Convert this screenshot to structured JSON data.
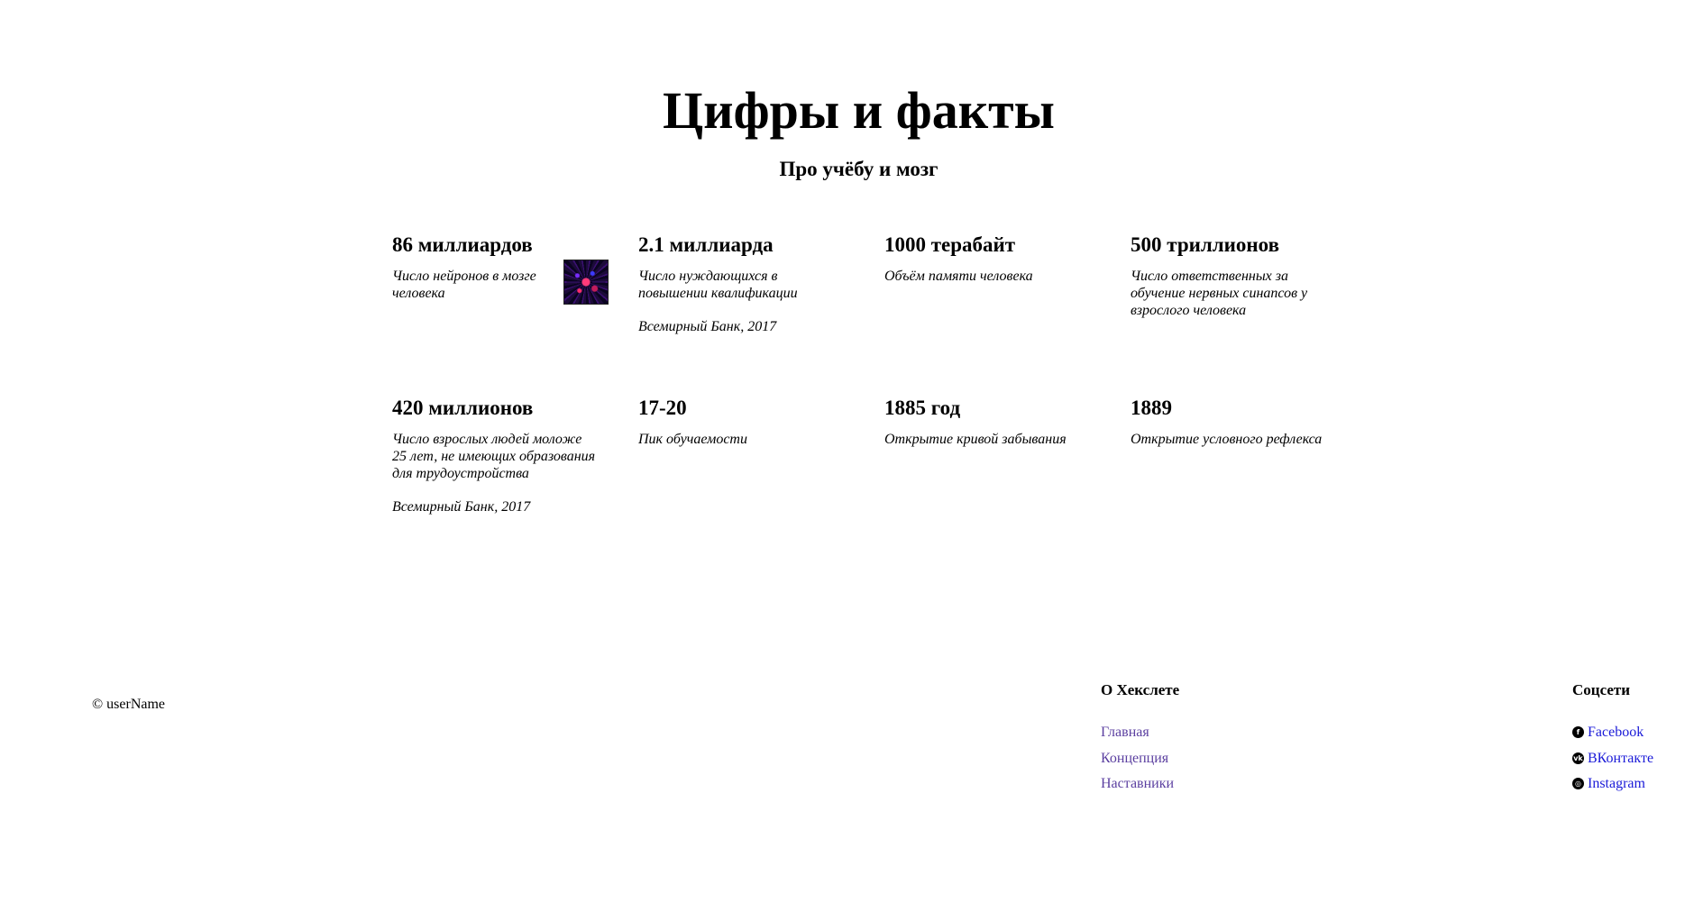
{
  "header": {
    "title": "Цифры и факты",
    "subtitle": "Про учёбу и мозг"
  },
  "facts": [
    {
      "value": "86 миллиардов",
      "description": "Число нейронов в мозге человека",
      "source": "",
      "thumbnail": "neuron-image"
    },
    {
      "value": "2.1 миллиарда",
      "description": "Число нуждающихся в повышении квалификации",
      "source": "Всемирный Банк, 2017"
    },
    {
      "value": "1000 терабайт",
      "description": "Объём памяти человека",
      "source": ""
    },
    {
      "value": "500 триллионов",
      "description": "Число ответственных за обучение нервных синапсов у взрослого человека",
      "source": ""
    },
    {
      "value": "420 миллионов",
      "description": "Число взрослых людей моложе 25 лет, не имеющих образования для трудоустройства",
      "source": "Всемирный Банк, 2017"
    },
    {
      "value": "17-20",
      "description": "Пик обучаемости",
      "source": ""
    },
    {
      "value": "1885 год",
      "description": "Открытие кривой забывания",
      "source": ""
    },
    {
      "value": "1889",
      "description": "Открытие условного рефлекса",
      "source": ""
    }
  ],
  "footer": {
    "copyright": "© userName",
    "about": {
      "heading": "О Хекслете",
      "links": [
        "Главная",
        "Концепция",
        "Наставники"
      ]
    },
    "social": {
      "heading": "Соцсети",
      "links": [
        {
          "label": "Facebook",
          "icon": "facebook-icon"
        },
        {
          "label": "ВКонтакте",
          "icon": "vk-icon"
        },
        {
          "label": "Instagram",
          "icon": "instagram-icon"
        }
      ]
    }
  },
  "colors": {
    "visited_link": "#5b3fa0",
    "link": "#1a1ad8"
  }
}
